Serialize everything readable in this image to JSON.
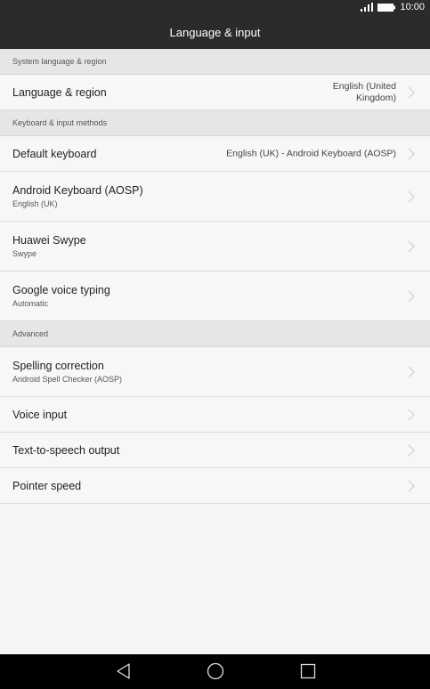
{
  "status": {
    "time": "10:00"
  },
  "header": {
    "title": "Language & input"
  },
  "sections": [
    {
      "header": "System language & region",
      "items": [
        {
          "title": "Language & region",
          "value_line1": "English (United",
          "value_line2": "Kingdom)"
        }
      ]
    },
    {
      "header": "Keyboard & input methods",
      "items": [
        {
          "title": "Default keyboard",
          "value": "English (UK) - Android Keyboard (AOSP)"
        },
        {
          "title": "Android Keyboard (AOSP)",
          "subtitle": "English (UK)"
        },
        {
          "title": "Huawei Swype",
          "subtitle": "Swype"
        },
        {
          "title": "Google voice typing",
          "subtitle": "Automatic"
        }
      ]
    },
    {
      "header": "Advanced",
      "items": [
        {
          "title": "Spelling correction",
          "subtitle": "Android Spell Checker (AOSP)"
        },
        {
          "title": "Voice input"
        },
        {
          "title": "Text-to-speech output"
        },
        {
          "title": "Pointer speed"
        }
      ]
    }
  ],
  "icons": {
    "signal": "signal-icon",
    "battery": "battery-icon",
    "chevron": "chevron-right-icon",
    "back": "back-icon",
    "home": "home-icon",
    "recents": "recents-icon"
  }
}
